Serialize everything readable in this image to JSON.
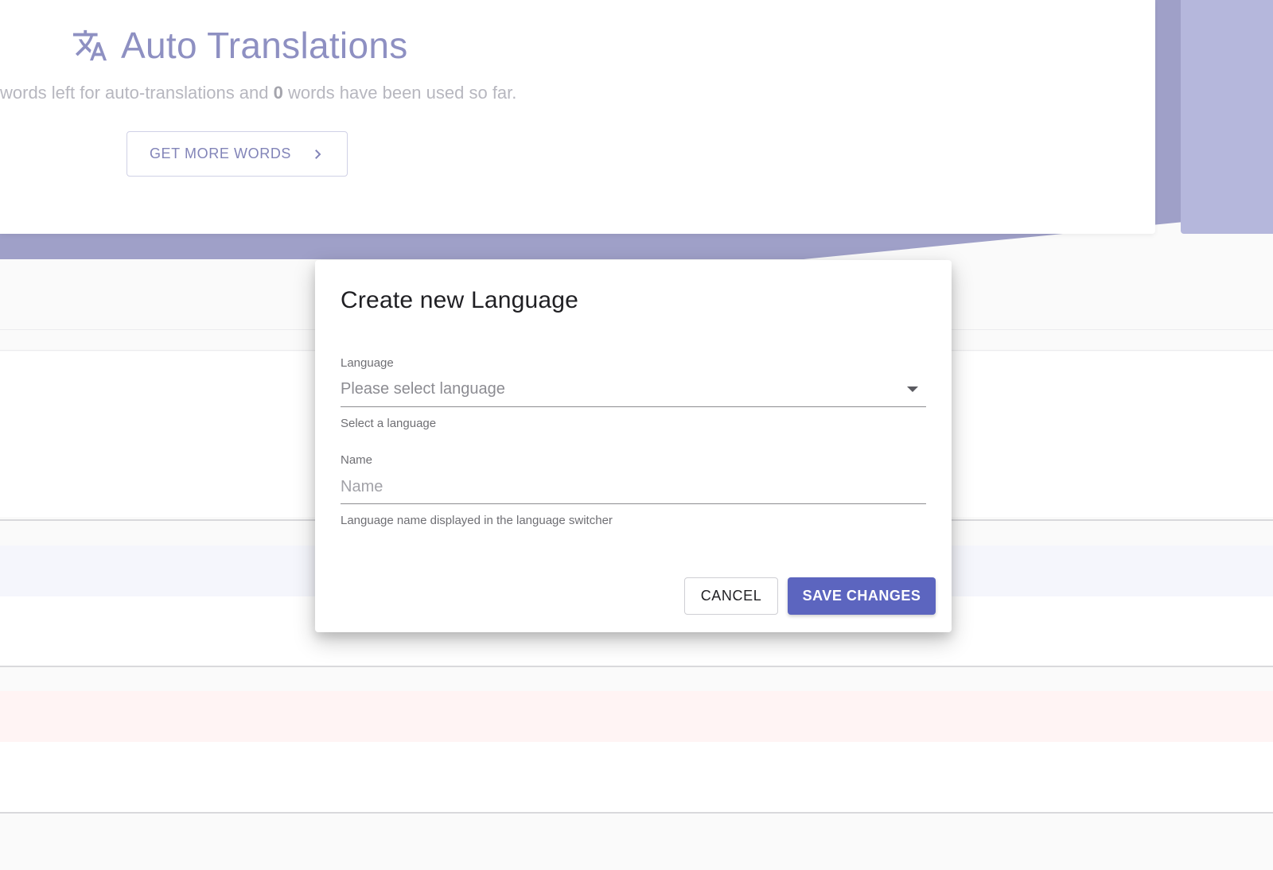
{
  "auto_translations": {
    "title": "Auto Translations",
    "desc_prefix": "words left for auto-translations and ",
    "used_words": "0",
    "desc_suffix": " words have been used so far.",
    "more_button_label": "GET MORE WORDS",
    "icon": "translate-icon"
  },
  "dialog": {
    "title": "Create new Language",
    "language_field": {
      "label": "Language",
      "value": "Please select language",
      "help": "Select a language"
    },
    "name_field": {
      "label": "Name",
      "placeholder": "Name",
      "value": "",
      "help": "Language name displayed in the language switcher"
    },
    "cancel_label": "CANCEL",
    "save_label": "SAVE CHANGES"
  },
  "colors": {
    "accent": "#5c65bf",
    "hero_band": "#9fa0c8",
    "title_text": "#8e90c2"
  }
}
